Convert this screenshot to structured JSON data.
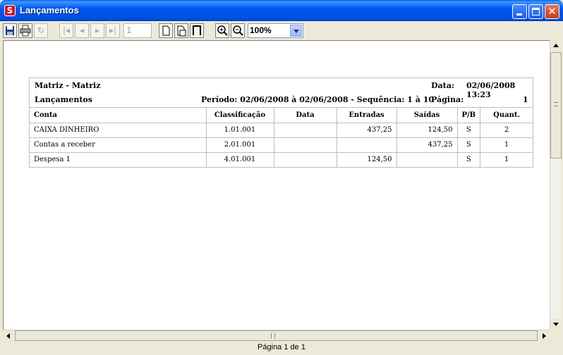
{
  "window": {
    "title": "Lançamentos",
    "app_icon_glyph": "S"
  },
  "toolbar": {
    "page_number": "1",
    "zoom": "100%",
    "icons": [
      "save-icon",
      "print-icon",
      "refresh-icon",
      "first-page-icon",
      "prev-page-icon",
      "next-page-icon",
      "last-page-icon",
      "single-page-icon",
      "two-pages-icon",
      "page-width-icon",
      "zoom-in-icon",
      "zoom-out-icon"
    ]
  },
  "report": {
    "company": "Matriz - Matriz",
    "title": "Lançamentos",
    "date_label": "Data:",
    "date_value": "02/06/2008 13:23",
    "period": "Período: 02/06/2008 à 02/06/2008  -  Sequência: 1 à 10",
    "page_label": "Página:",
    "page_value": "1",
    "columns": [
      "Conta",
      "Classificação",
      "Data",
      "Entradas",
      "Saídas",
      "P/B",
      "Quant."
    ],
    "rows": [
      {
        "conta": "CAIXA DINHEIRO",
        "classificacao": "1.01.001",
        "data": "",
        "entradas": "437,25",
        "saidas": "124,50",
        "pb": "S",
        "quant": "2"
      },
      {
        "conta": "Contas a receber",
        "classificacao": "2.01.001",
        "data": "",
        "entradas": "",
        "saidas": "437,25",
        "pb": "S",
        "quant": "1"
      },
      {
        "conta": "Despesa 1",
        "classificacao": "4.01.001",
        "data": "",
        "entradas": "124,50",
        "saidas": "",
        "pb": "S",
        "quant": "1"
      }
    ]
  },
  "status": {
    "page_info": "Página 1 de 1"
  }
}
